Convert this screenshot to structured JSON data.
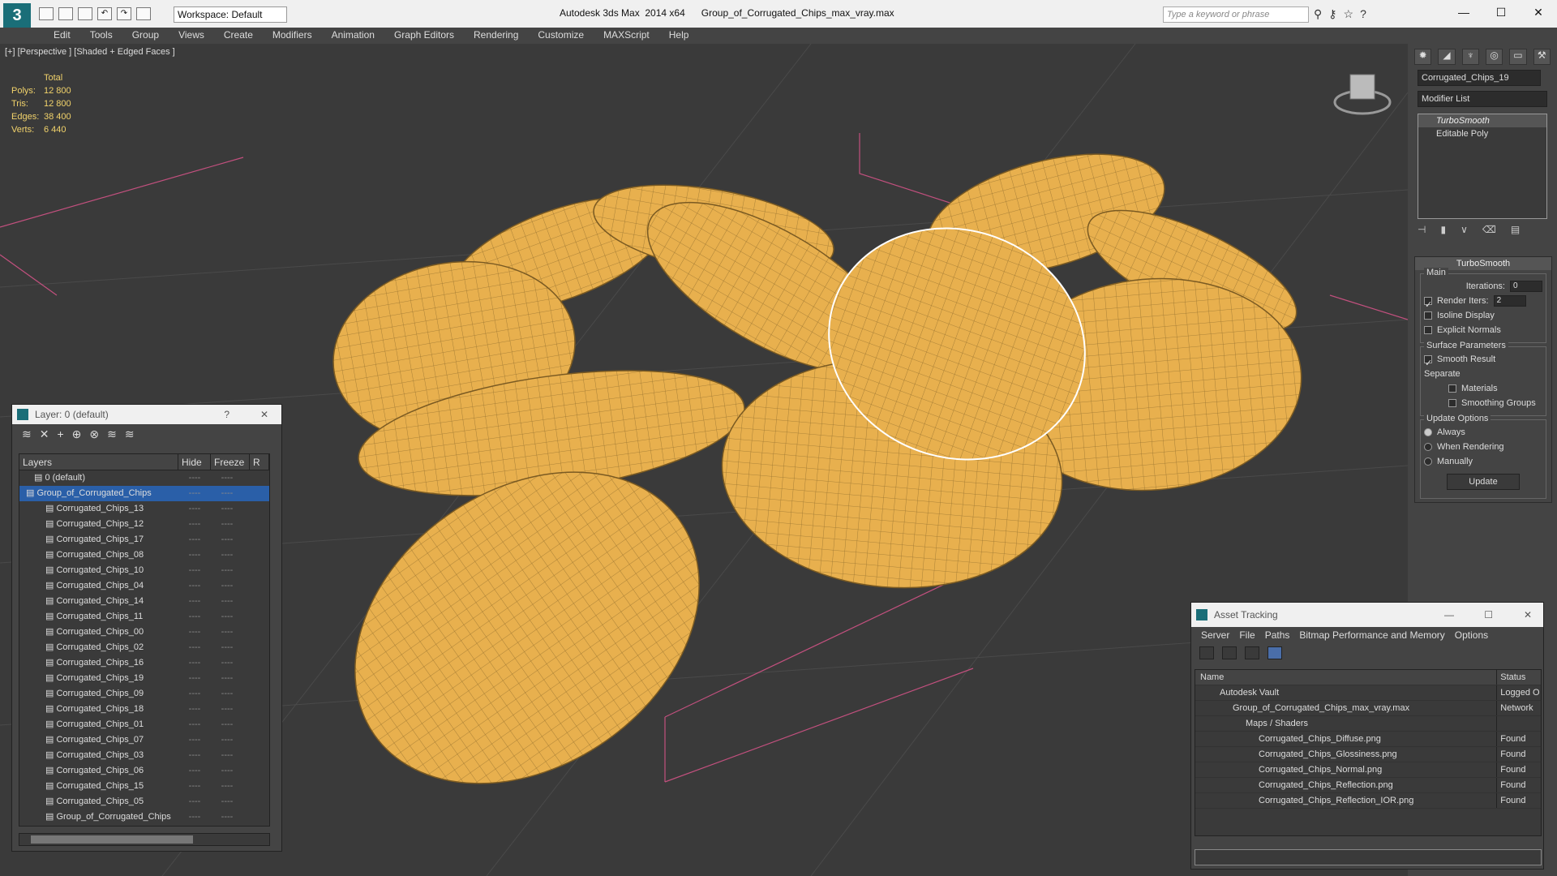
{
  "titlebar": {
    "workspace": "Workspace: Default",
    "app_title": "Autodesk 3ds Max  2014 x64      Group_of_Corrugated_Chips_max_vray.max",
    "search_placeholder": "Type a keyword or phrase"
  },
  "menu": [
    "Edit",
    "Tools",
    "Group",
    "Views",
    "Create",
    "Modifiers",
    "Animation",
    "Graph Editors",
    "Rendering",
    "Customize",
    "MAXScript",
    "Help"
  ],
  "viewport": {
    "label": "[+] [Perspective ] [Shaded + Edged Faces ]",
    "stats": {
      "total_label": "Total",
      "rows": [
        {
          "k": "Polys:",
          "v": "12 800"
        },
        {
          "k": "Tris:",
          "v": "12 800"
        },
        {
          "k": "Edges:",
          "v": "38 400"
        },
        {
          "k": "Verts:",
          "v": "6 440"
        }
      ]
    }
  },
  "command_panel": {
    "object_name": "Corrugated_Chips_19",
    "modifier_list": "Modifier List",
    "stack": [
      "TurboSmooth",
      "Editable Poly"
    ],
    "rollup_title": "TurboSmooth",
    "main_caption": "Main",
    "iterations_label": "Iterations:",
    "iterations_value": "0",
    "render_iters_label": "Render Iters:",
    "render_iters_value": "2",
    "isoline": "Isoline Display",
    "explicit_normals": "Explicit Normals",
    "surface_caption": "Surface Parameters",
    "smooth_result": "Smooth Result",
    "separate": "Separate",
    "materials": "Materials",
    "smoothing_groups": "Smoothing Groups",
    "update_caption": "Update Options",
    "always": "Always",
    "when_rendering": "When Rendering",
    "manually": "Manually",
    "update_button": "Update"
  },
  "layer_window": {
    "title": "Layer: 0 (default)",
    "help": "?",
    "close": "✕",
    "col_layers": "Layers",
    "col_hide": "Hide",
    "col_freeze": "Freeze",
    "col_r": "R",
    "rows": [
      "0 (default)",
      "Group_of_Corrugated_Chips",
      "Corrugated_Chips_13",
      "Corrugated_Chips_12",
      "Corrugated_Chips_17",
      "Corrugated_Chips_08",
      "Corrugated_Chips_10",
      "Corrugated_Chips_04",
      "Corrugated_Chips_14",
      "Corrugated_Chips_11",
      "Corrugated_Chips_00",
      "Corrugated_Chips_02",
      "Corrugated_Chips_16",
      "Corrugated_Chips_19",
      "Corrugated_Chips_09",
      "Corrugated_Chips_18",
      "Corrugated_Chips_01",
      "Corrugated_Chips_07",
      "Corrugated_Chips_03",
      "Corrugated_Chips_06",
      "Corrugated_Chips_15",
      "Corrugated_Chips_05",
      "Group_of_Corrugated_Chips"
    ],
    "cell_mark": "----"
  },
  "asset_window": {
    "title": "Asset Tracking",
    "menu": [
      "Server",
      "File",
      "Paths",
      "Bitmap Performance and Memory",
      "Options"
    ],
    "col_name": "Name",
    "col_status": "Status",
    "rows": [
      {
        "name": "Autodesk Vault",
        "status": "Logged O"
      },
      {
        "name": "Group_of_Corrugated_Chips_max_vray.max",
        "status": "Network"
      },
      {
        "name": "Maps / Shaders",
        "status": ""
      },
      {
        "name": "Corrugated_Chips_Diffuse.png",
        "status": "Found"
      },
      {
        "name": "Corrugated_Chips_Glossiness.png",
        "status": "Found"
      },
      {
        "name": "Corrugated_Chips_Normal.png",
        "status": "Found"
      },
      {
        "name": "Corrugated_Chips_Reflection.png",
        "status": "Found"
      },
      {
        "name": "Corrugated_Chips_Reflection_IOR.png",
        "status": "Found"
      }
    ]
  },
  "colors": {
    "chip": "#e8b04e",
    "wire": "#8a6a2c",
    "grid": "#555555",
    "pinkline": "#d05a8a"
  }
}
